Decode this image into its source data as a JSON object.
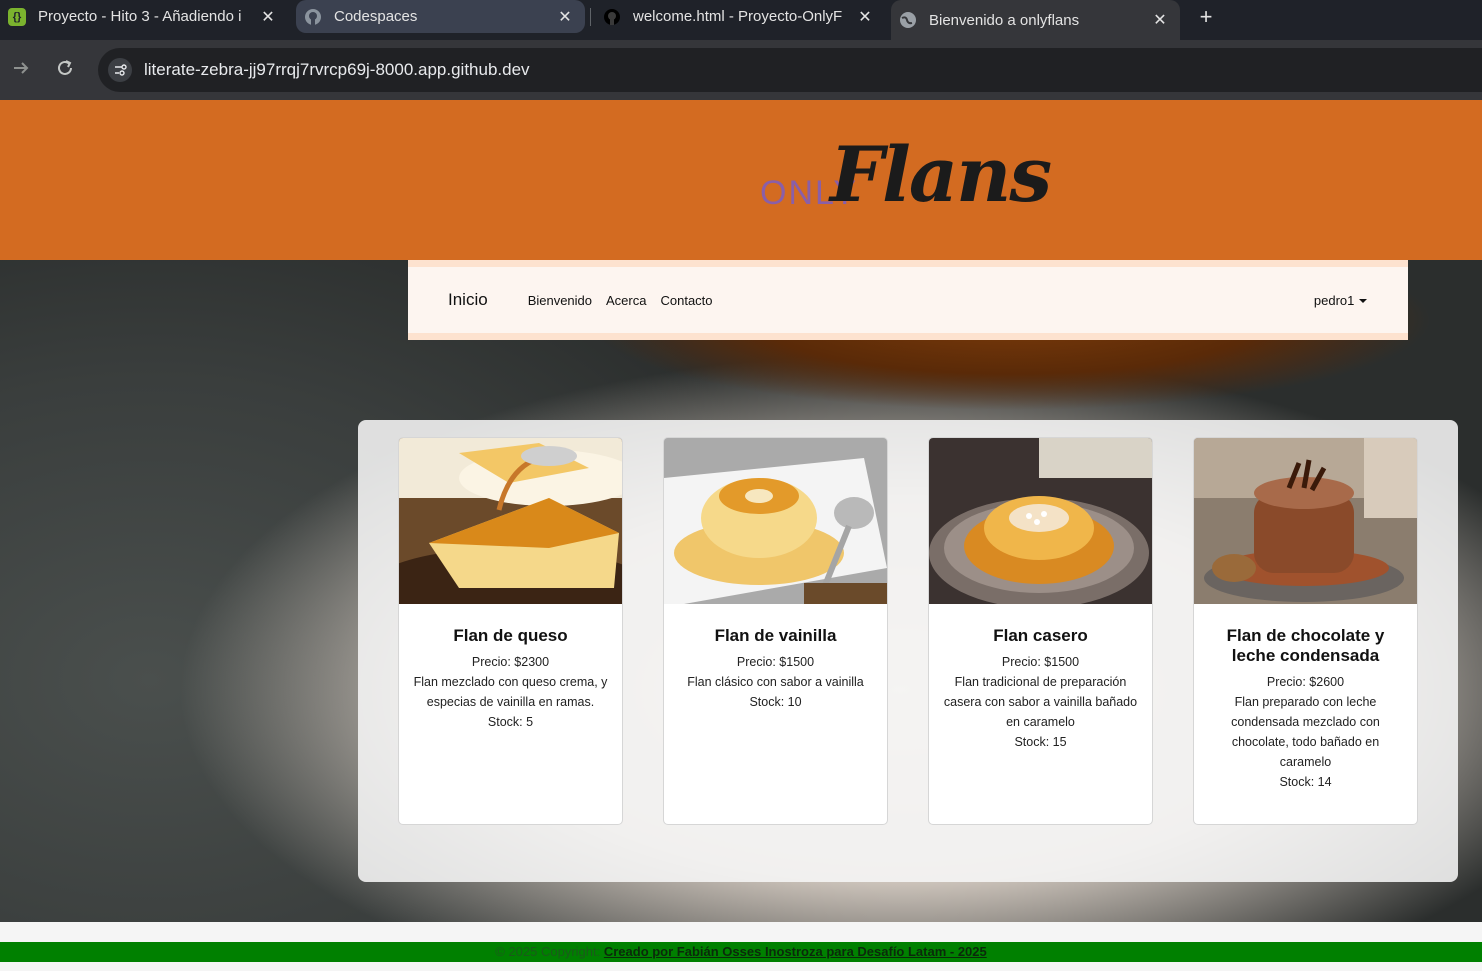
{
  "browser": {
    "tabs": [
      {
        "title": "Proyecto - Hito 3 - Añadiendo i",
        "icon": "replit-icon"
      },
      {
        "title": "Codespaces",
        "icon": "github-icon"
      },
      {
        "title": "welcome.html - Proyecto-OnlyF",
        "icon": "github-icon"
      },
      {
        "title": "Bienvenido a onlyflans",
        "icon": "globe-icon"
      }
    ],
    "close_glyph": "✕",
    "new_tab_glyph": "+",
    "url": "literate-zebra-jj97rrqj7rvrcp69j-8000.app.github.dev"
  },
  "site": {
    "logo_only": "ONLY",
    "logo_flans": "Flans",
    "nav": {
      "brand": "Inicio",
      "links": [
        "Bienvenido",
        "Acerca",
        "Contacto"
      ],
      "user": "pedro1"
    },
    "products": [
      {
        "name": "Flan de queso",
        "price": "Precio: $2300",
        "desc": "Flan mezclado con queso crema, y especias de vainilla en ramas.",
        "stock": "Stock: 5"
      },
      {
        "name": "Flan de vainilla",
        "price": "Precio: $1500",
        "desc": "Flan clásico con sabor a vainilla",
        "stock": "Stock: 10"
      },
      {
        "name": "Flan casero",
        "price": "Precio: $1500",
        "desc": "Flan tradicional de preparación casera con sabor a vainilla bañado en caramelo",
        "stock": "Stock: 15"
      },
      {
        "name": "Flan de chocolate y leche condensada",
        "price": "Precio: $2600",
        "desc": "Flan preparado con leche condensada mezclado con chocolate, todo bañado en caramelo",
        "stock": "Stock: 14"
      }
    ],
    "footer": {
      "prefix": "© 2025 Copyright: ",
      "link": "Creado por Fabián Osses Inostroza para Desafío Latam - 2025"
    }
  },
  "colors": {
    "header": "#d36b21",
    "footer": "#008000",
    "navbar": "#fdf5f0"
  }
}
